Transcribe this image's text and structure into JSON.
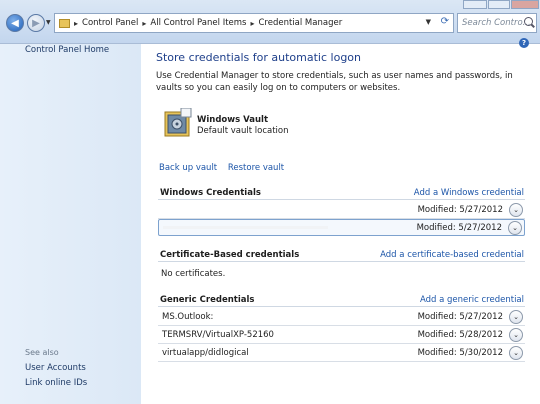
{
  "addressbar": {
    "crumbs": [
      "Control Panel",
      "All Control Panel Items",
      "Credential Manager"
    ],
    "search_placeholder": "Search Contro..."
  },
  "leftpane": {
    "home_link": "Control Panel Home",
    "see_also": "See also",
    "links": [
      "User Accounts",
      "Link online IDs"
    ]
  },
  "main": {
    "title": "Store credentials for automatic logon",
    "description": "Use Credential Manager to store credentials, such as user names and passwords, in vaults so you can easily log on to computers or websites.",
    "vault": {
      "name": "Windows Vault",
      "subtitle": "Default vault location"
    },
    "vault_links": {
      "backup": "Back up vault",
      "restore": "Restore vault"
    },
    "sections": {
      "windows": {
        "title": "Windows Credentials",
        "add_label": "Add a Windows credential",
        "rows": [
          {
            "name": "",
            "modified": "Modified:  5/27/2012"
          },
          {
            "name": "",
            "modified": "Modified:  5/27/2012"
          }
        ]
      },
      "certificate": {
        "title": "Certificate-Based credentials",
        "add_label": "Add a certificate-based credential",
        "empty_text": "No certificates."
      },
      "generic": {
        "title": "Generic Credentials",
        "add_label": "Add a generic credential",
        "rows": [
          {
            "name": "MS.Outlook:",
            "modified": "Modified:  5/27/2012"
          },
          {
            "name": "TERMSRV/VirtualXP-52160",
            "modified": "Modified:  5/28/2012"
          },
          {
            "name": "virtualapp/didlogical",
            "modified": "Modified:  5/30/2012"
          }
        ]
      }
    }
  }
}
